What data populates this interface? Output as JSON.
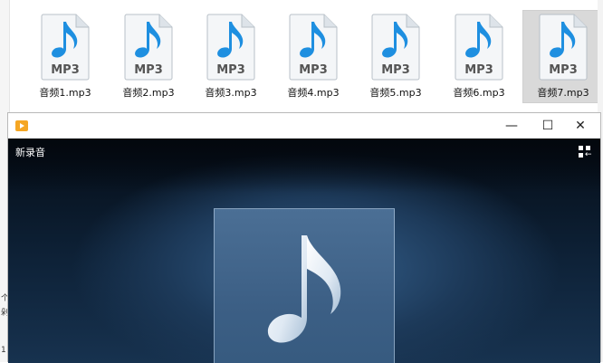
{
  "explorer": {
    "files": [
      {
        "name": "音频1.mp3",
        "badge": "MP3",
        "selected": false
      },
      {
        "name": "音频2.mp3",
        "badge": "MP3",
        "selected": false
      },
      {
        "name": "音频3.mp3",
        "badge": "MP3",
        "selected": false
      },
      {
        "name": "音频4.mp3",
        "badge": "MP3",
        "selected": false
      },
      {
        "name": "音频5.mp3",
        "badge": "MP3",
        "selected": false
      },
      {
        "name": "音频6.mp3",
        "badge": "MP3",
        "selected": false
      },
      {
        "name": "音频7.mp3",
        "badge": "MP3",
        "selected": true
      }
    ],
    "left_fragments": [
      "个",
      "剁",
      "1"
    ]
  },
  "player": {
    "icon": "media-player-icon",
    "controls": {
      "minimize": "—",
      "maximize": "☐",
      "close": "✕"
    },
    "recording_title": "新录音",
    "view_toggle_icon": "playlist-toggle-icon",
    "album_art_icon": "music-note-icon"
  },
  "colors": {
    "note_blue": "#1e8fe0",
    "player_bg_dark": "#050d17",
    "selection_gray": "#d9d9d9"
  }
}
